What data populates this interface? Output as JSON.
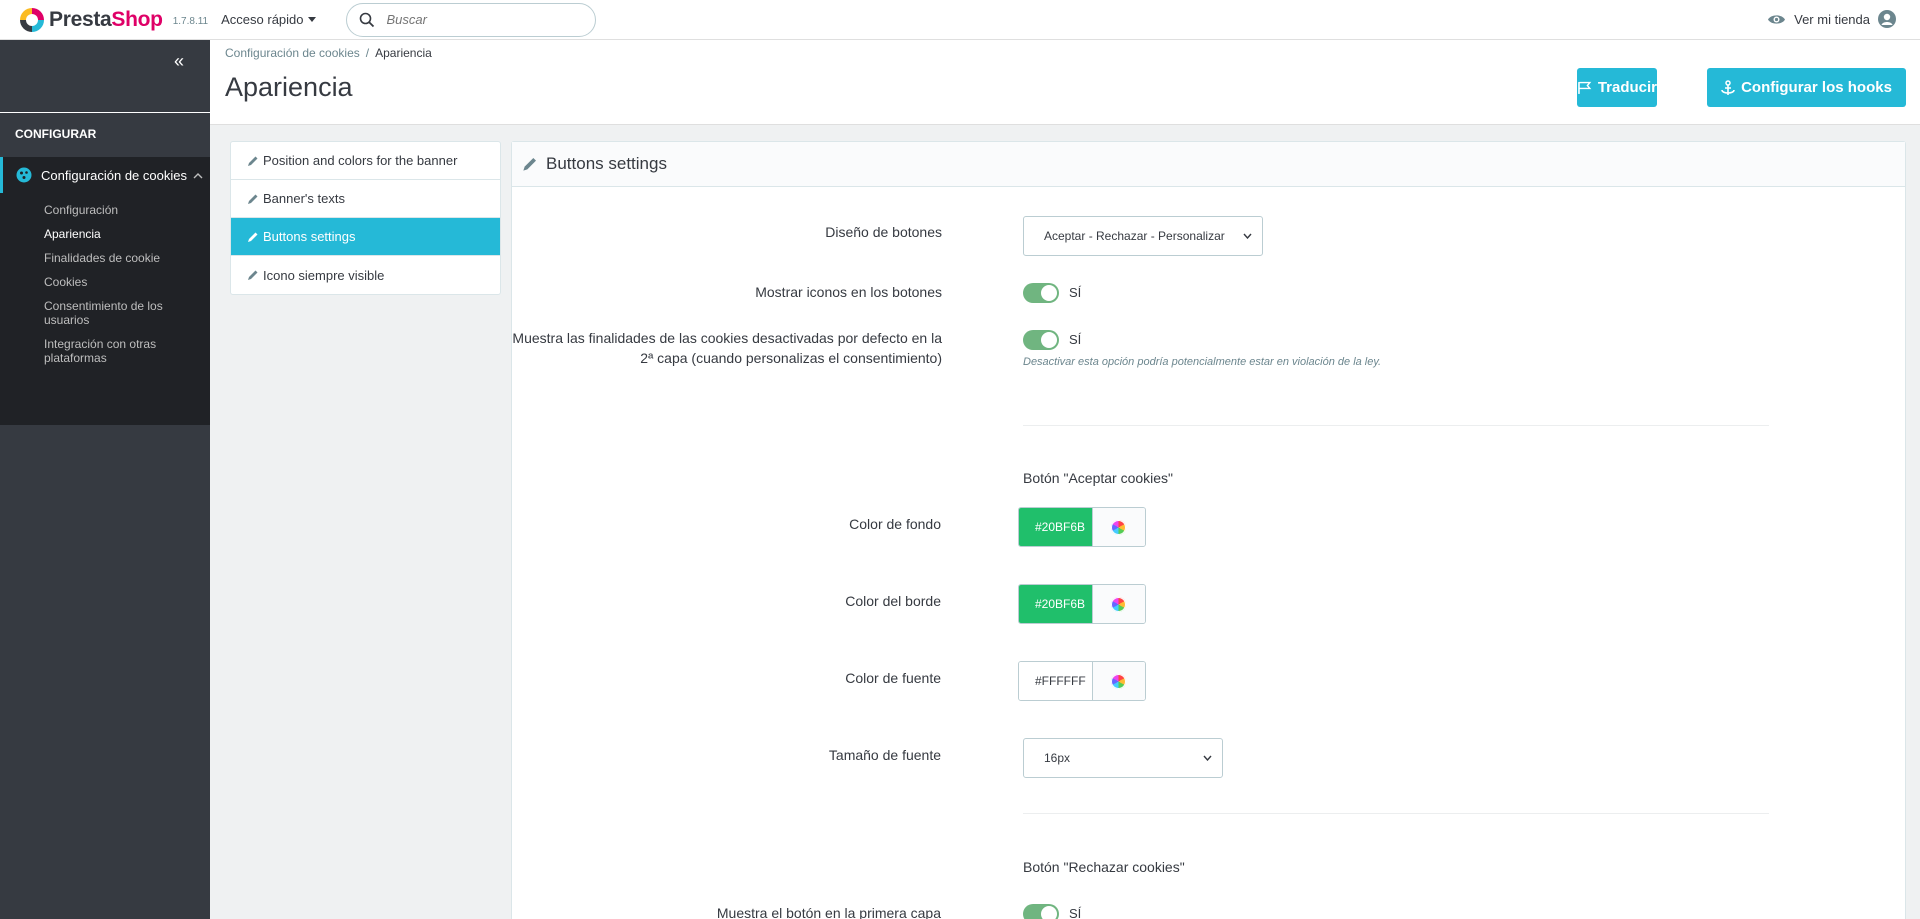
{
  "header": {
    "logo_left": "Presta",
    "logo_right": "Shop",
    "version": "1.7.8.11",
    "quick_access": "Acceso rápido",
    "search_placeholder": "Buscar",
    "view_store": "Ver mi tienda"
  },
  "sidebar": {
    "section": "CONFIGURAR",
    "group": "Configuración de cookies",
    "items": [
      {
        "label": "Configuración",
        "active": false
      },
      {
        "label": "Apariencia",
        "active": true
      },
      {
        "label": "Finalidades de cookie",
        "active": false
      },
      {
        "label": "Cookies",
        "active": false
      },
      {
        "label": "Consentimiento de los usuarios",
        "active": false
      },
      {
        "label": "Integración con otras plataformas",
        "active": false
      }
    ]
  },
  "page": {
    "breadcrumb": [
      "Configuración de cookies",
      "Apariencia"
    ],
    "title": "Apariencia",
    "buttons": {
      "translate": "Traducir",
      "hooks": "Configurar los hooks"
    }
  },
  "tabs": [
    {
      "label": "Position and colors for the banner",
      "active": false
    },
    {
      "label": "Banner's texts",
      "active": false
    },
    {
      "label": "Buttons settings",
      "active": true
    },
    {
      "label": "Icono siempre visible",
      "active": false
    }
  ],
  "panel": {
    "title": "Buttons settings",
    "button_design": {
      "label": "Diseño de botones",
      "value": "Aceptar - Rechazar - Personalizar"
    },
    "show_icons": {
      "label": "Mostrar iconos en los botones",
      "value": "SÍ"
    },
    "show_purposes": {
      "label": "Muestra las finalidades de las cookies desactivadas por defecto en la 2ª capa (cuando personalizas el consentimiento)",
      "value": "SÍ",
      "help": "Desactivar esta opción podría potencialmente estar en violación de la ley."
    },
    "accept_heading": "Botón \"Aceptar cookies\"",
    "bg_color": {
      "label": "Color de fondo",
      "value": "#20BF6B",
      "swatch": "#20bf6b"
    },
    "border_color": {
      "label": "Color del borde",
      "value": "#20BF6B",
      "swatch": "#20bf6b"
    },
    "font_color": {
      "label": "Color de fuente",
      "value": "#FFFFFF",
      "swatch": "#ffffff"
    },
    "font_size": {
      "label": "Tamaño de fuente",
      "value": "16px"
    },
    "reject_heading": "Botón \"Rechazar cookies\"",
    "reject_show": {
      "label": "Muestra el botón en la primera capa",
      "value": "SÍ"
    }
  }
}
